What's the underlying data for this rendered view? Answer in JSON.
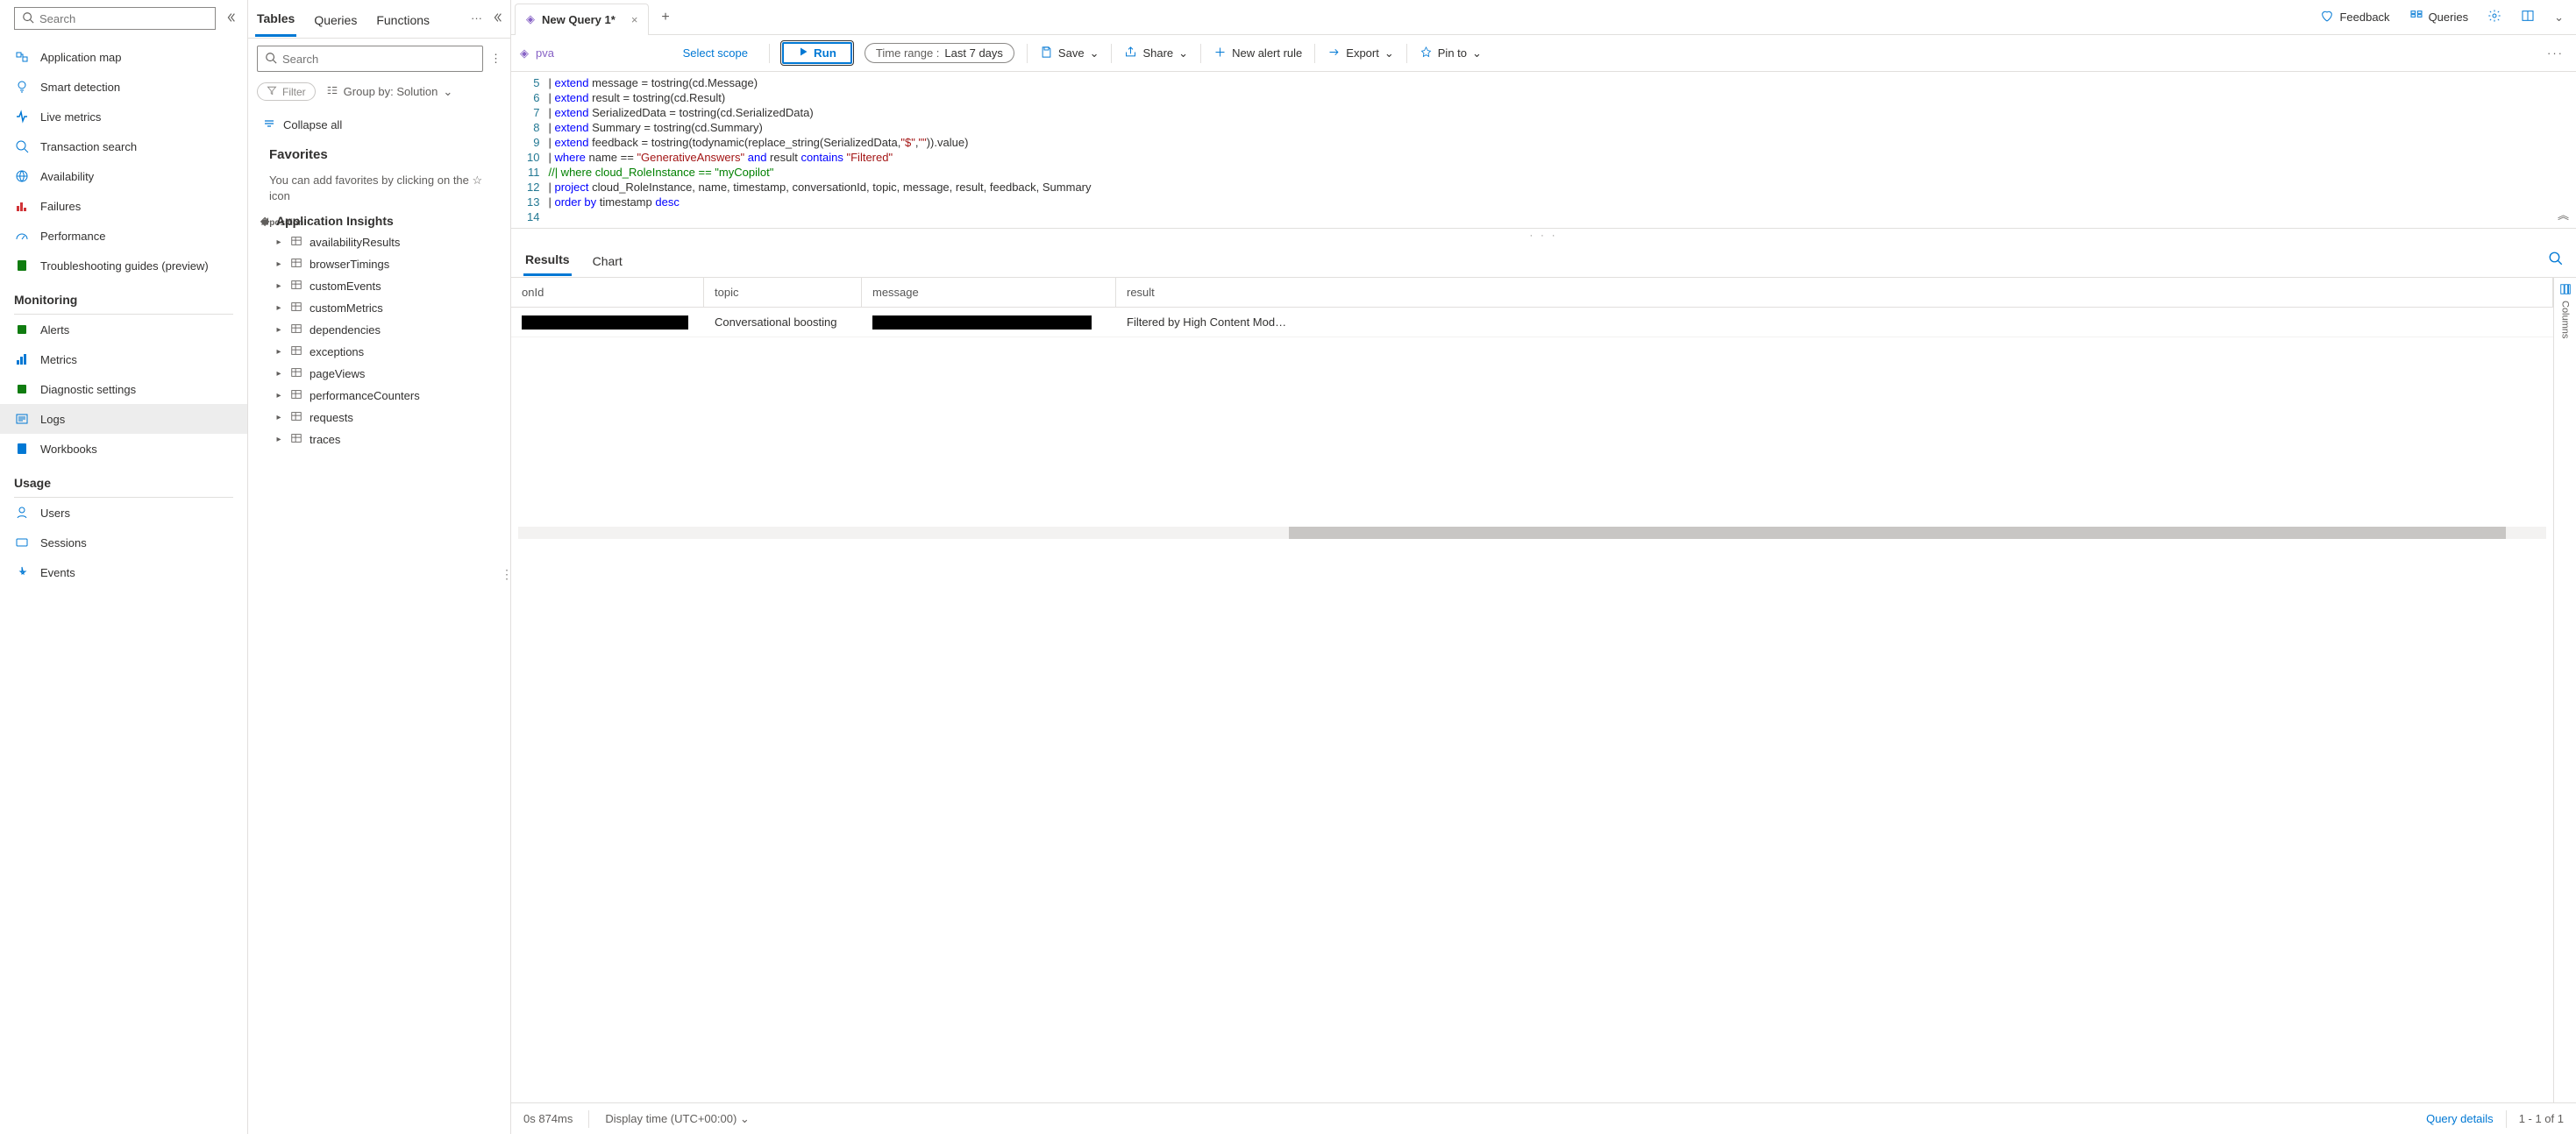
{
  "sidebar": {
    "search_placeholder": "Search",
    "partial_top_label": "",
    "items_a": [
      {
        "label": "Application map",
        "icon": "map",
        "color": "#0078d4"
      },
      {
        "label": "Smart detection",
        "icon": "bulb",
        "color": "#0078d4"
      },
      {
        "label": "Live metrics",
        "icon": "pulse",
        "color": "#0078d4"
      },
      {
        "label": "Transaction search",
        "icon": "search",
        "color": "#0078d4"
      },
      {
        "label": "Availability",
        "icon": "globe",
        "color": "#0078d4"
      },
      {
        "label": "Failures",
        "icon": "bars",
        "color": "#d13438"
      },
      {
        "label": "Performance",
        "icon": "gauge",
        "color": "#0078d4"
      },
      {
        "label": "Troubleshooting guides (preview)",
        "icon": "guide",
        "color": "#107c10"
      }
    ],
    "section_monitoring": "Monitoring",
    "items_mon": [
      {
        "label": "Alerts",
        "icon": "alert",
        "color": "#107c10"
      },
      {
        "label": "Metrics",
        "icon": "metrics",
        "color": "#0078d4"
      },
      {
        "label": "Diagnostic settings",
        "icon": "diag",
        "color": "#107c10"
      },
      {
        "label": "Logs",
        "icon": "logs",
        "color": "#0078d4",
        "active": true
      },
      {
        "label": "Workbooks",
        "icon": "workbook",
        "color": "#0078d4"
      }
    ],
    "section_usage": "Usage",
    "items_usage": [
      {
        "label": "Users",
        "icon": "user",
        "color": "#0078d4"
      },
      {
        "label": "Sessions",
        "icon": "session",
        "color": "#0078d4"
      },
      {
        "label": "Events",
        "icon": "event",
        "color": "#0078d4"
      }
    ]
  },
  "mid": {
    "tabs": [
      "Tables",
      "Queries",
      "Functions"
    ],
    "active_tab": 0,
    "search_placeholder": "Search",
    "filter_label": "Filter",
    "groupby_label": "Group by: Solution",
    "collapse_all": "Collapse all",
    "favorites_heading": "Favorites",
    "favorites_help": "You can add favorites by clicking on the ☆ icon",
    "tree_root": "Application Insights",
    "tree_items": [
      "availabilityResults",
      "browserTimings",
      "customEvents",
      "customMetrics",
      "dependencies",
      "exceptions",
      "pageViews",
      "performanceCounters",
      "requests",
      "traces"
    ]
  },
  "topbar": {
    "tab_title": "New Query 1*",
    "feedback": "Feedback",
    "queries": "Queries"
  },
  "toolbar": {
    "scope_value": "pva",
    "select_scope": "Select scope",
    "run": "Run",
    "time_label": "Time range :",
    "time_value": "Last 7 days",
    "save": "Save",
    "share": "Share",
    "new_alert": "New alert rule",
    "export": "Export",
    "pin": "Pin to"
  },
  "editor": {
    "first_line": 5,
    "lines": [
      {
        "t": "| <kw>extend</kw> message = tostring(cd.Message)"
      },
      {
        "t": "| <kw>extend</kw> result = tostring(cd.Result)"
      },
      {
        "t": "| <kw>extend</kw> SerializedData = tostring(cd.SerializedData)"
      },
      {
        "t": "| <kw>extend</kw> Summary = tostring(cd.Summary)"
      },
      {
        "t": "| <kw>extend</kw> feedback = tostring(todynamic(replace_string(SerializedData,<str>\"$\"</str>,<str>\"\"</str>)).value)"
      },
      {
        "t": "| <kw>where</kw> name == <str>\"GenerativeAnswers\"</str> <kw>and</kw> result <kw>contains</kw> <str>\"Filtered\"</str>"
      },
      {
        "t": "<cmt>//| where cloud_RoleInstance == \"myCopilot\"</cmt>"
      },
      {
        "t": "| <kw>project</kw> cloud_RoleInstance, name, timestamp, conversationId, topic, message, result, feedback, Summary"
      },
      {
        "t": "| <kw>order by</kw> timestamp <kw>desc</kw>"
      },
      {
        "t": ""
      }
    ]
  },
  "results": {
    "tabs": [
      "Results",
      "Chart"
    ],
    "columns": [
      "onId",
      "topic",
      "message",
      "result"
    ],
    "columns_btn": "Columns",
    "row": {
      "topic": "Conversational boosting",
      "result": "Filtered by High Content Mod…"
    }
  },
  "status": {
    "duration": "0s 874ms",
    "display_time": "Display time (UTC+00:00)",
    "query_details": "Query details",
    "pager": "1 - 1 of 1"
  }
}
